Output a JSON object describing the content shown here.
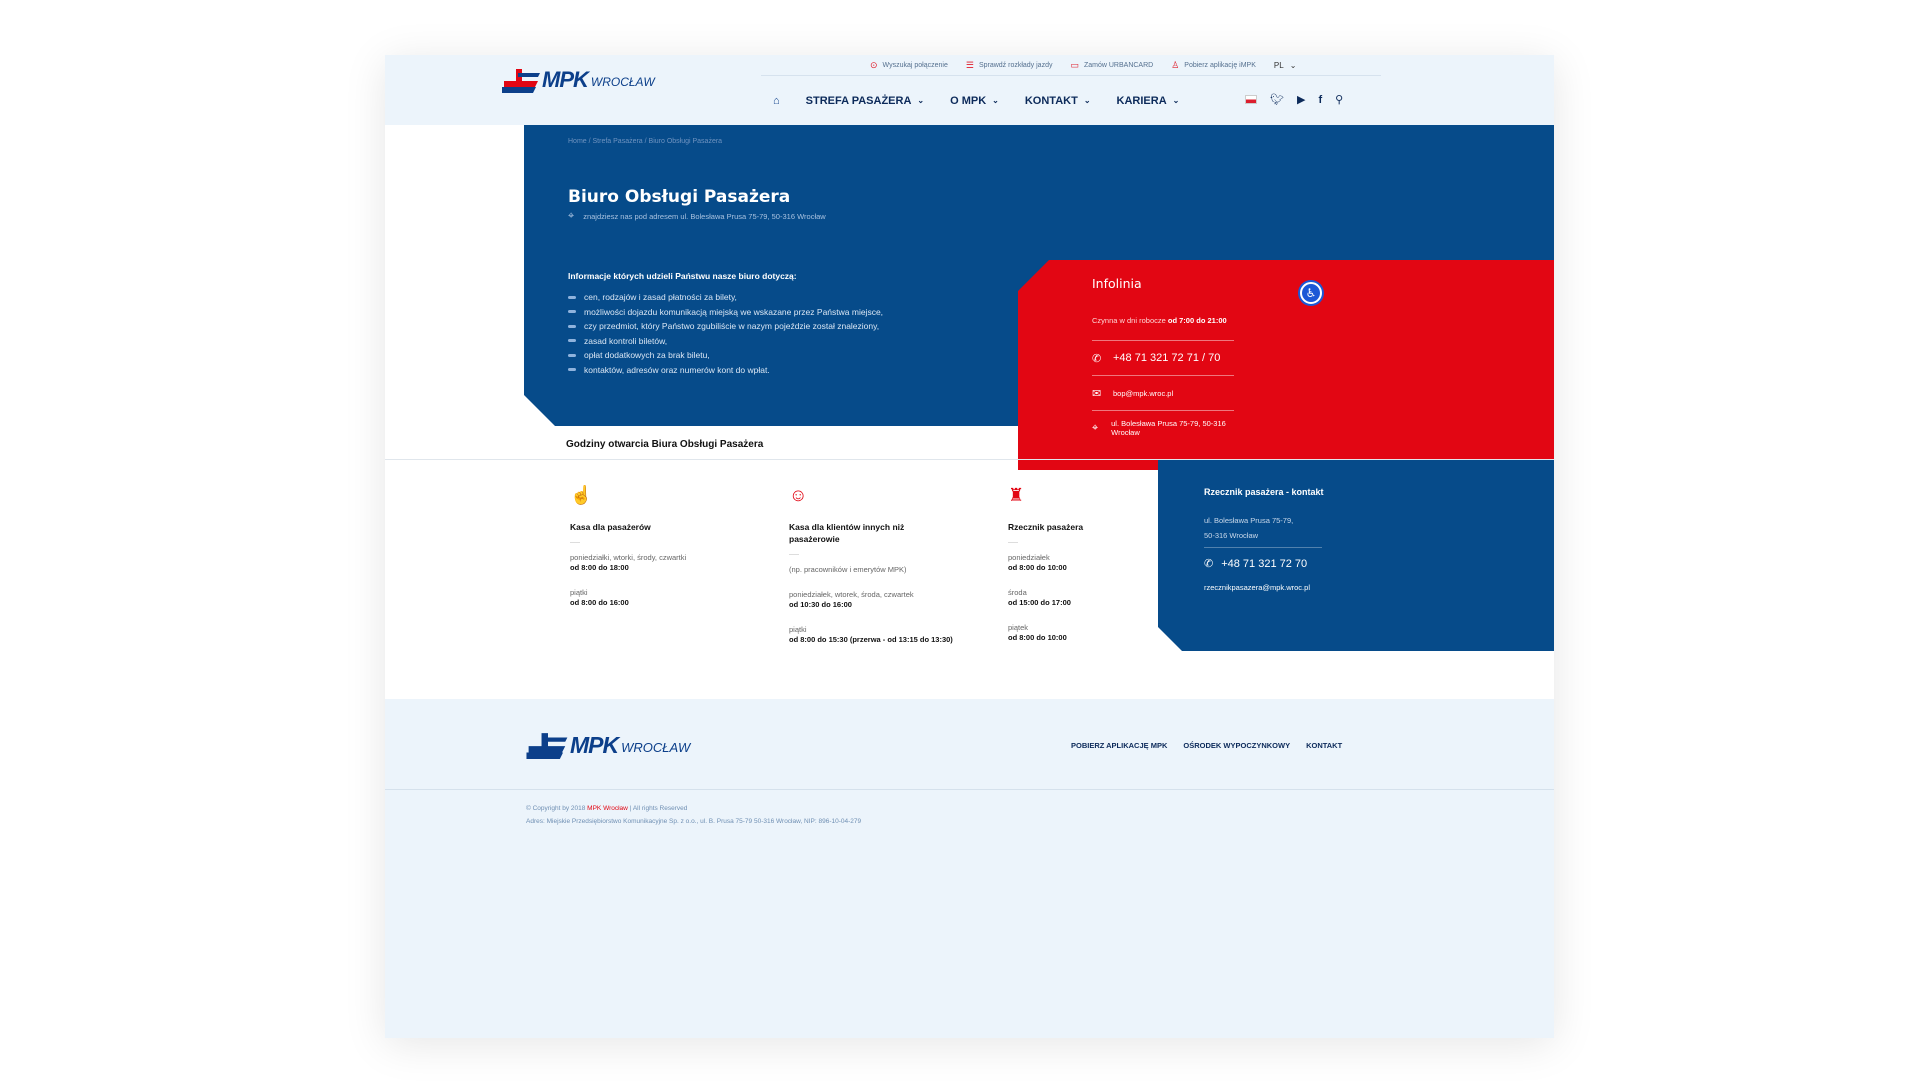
{
  "colors": {
    "brand_blue": "#064b8a",
    "brand_red": "#e20613",
    "nav_text": "#0c2a5a",
    "header_bg": "#ecf4fb"
  },
  "logo": {
    "main": "MPK",
    "sub": "WROCŁAW"
  },
  "topbar": {
    "items": [
      {
        "icon": "search-route-icon",
        "label": "Wyszukaj połączenie"
      },
      {
        "icon": "list-icon",
        "label": "Sprawdź rozkłady jazdy"
      },
      {
        "icon": "card-icon",
        "label": "Zamów URBANCARD"
      },
      {
        "icon": "user-add-icon",
        "label": "Pobierz aplikację iMPK"
      }
    ],
    "lang": "PL"
  },
  "nav": {
    "home_icon": "home-icon",
    "items": [
      {
        "label": "STREFA PASAŻERA"
      },
      {
        "label": "O MPK"
      },
      {
        "label": "KONTAKT"
      },
      {
        "label": "KARIERA"
      }
    ],
    "social": [
      "bip-flag-icon",
      "twitter-icon",
      "youtube-icon",
      "facebook-icon",
      "search-icon"
    ]
  },
  "hero": {
    "breadcrumb": "Home / Strefa Pasażera / Biuro Obsługi Pasażera",
    "title": "Biuro Obsługi Pasażera",
    "address": "znajdziesz nas pod adresem ul. Bolesława Prusa 75-79, 50-316 Wrocław",
    "info_heading": "Informacje których udzieli Państwu nasze biuro dotyczą:",
    "bullets": [
      "cen, rodzajów i zasad płatności za bilety,",
      "możliwości dojazdu komunikacją miejską we wskazane przez Państwa miejsce,",
      "czy przedmiot, który Państwo zgubiliście w nazym pojeździe został znaleziony,",
      "zasad kontroli biletów,",
      "opłat dodatkowych za brak biletu,",
      "kontaktów, adresów oraz numerów kont do wpłat."
    ]
  },
  "infolinia": {
    "title": "Infolinia",
    "hours_prefix": "Czynna w dni robocze",
    "hours_value": "od 7:00 do 21:00",
    "phone": "+48 71 321 72 71  / 70",
    "email": "bop@mpk.wroc.pl",
    "address": "ul. Bolesława Prusa 75-79,  50-316 Wrocław"
  },
  "hours": {
    "title": "Godziny otwarcia Biura Obsługi Pasażera",
    "columns": [
      {
        "icon": "ticket-hand-icon",
        "title": "Kasa dla pasażerów",
        "note": "",
        "entries": [
          {
            "label": "poniedziałki, wtorki, środy, czwartki",
            "value": "od 8:00 do 18:00"
          },
          {
            "label": "piątki",
            "value": "od 8:00 do 16:00"
          }
        ]
      },
      {
        "icon": "group-icon",
        "title": "Kasa dla klientów innych niż pasażerowie",
        "note": "(np. pracowników i emerytów MPK)",
        "entries": [
          {
            "label": "poniedziałek, wtorek, środa, czwartek",
            "value": "od 10:30 do 16:00"
          },
          {
            "label": "piątki",
            "value": "od 8:00 do 15:30 (przerwa - od 13:15 do 13:30)"
          }
        ]
      },
      {
        "icon": "ombudsman-icon",
        "title": "Rzecznik pasażera",
        "note": "",
        "entries": [
          {
            "label": "poniedziałek",
            "value": "od 8:00 do 10:00"
          },
          {
            "label": "środa",
            "value": "od 15:00 do 17:00"
          },
          {
            "label": "piątek",
            "value": "od 8:00 do 10:00"
          }
        ]
      }
    ]
  },
  "rzecznik": {
    "title": "Rzecznik pasażera - kontakt",
    "address_line1": "ul. Bolesława Prusa 75-79,",
    "address_line2": "50-316 Wrocław",
    "phone": "+48 71 321 72 70",
    "email": "rzecznikpasazera@mpk.wroc.pl"
  },
  "footer": {
    "links": [
      "POBIERZ APLIKACJĘ MPK",
      "OŚRODEK WYPOCZYNKOWY",
      "KONTAKT"
    ],
    "copyright_prefix": "© Copyright by 2018",
    "copyright_brand": "MPK Wrocław",
    "copyright_suffix": "| All rights Reserved",
    "address": "Adres:  Miejskie Przedsiębiorstwo Komunikacyjne Sp. z o.o., ul. B. Prusa 75-79 50-316 Wrocław, NIP: 896-10-04-279"
  }
}
